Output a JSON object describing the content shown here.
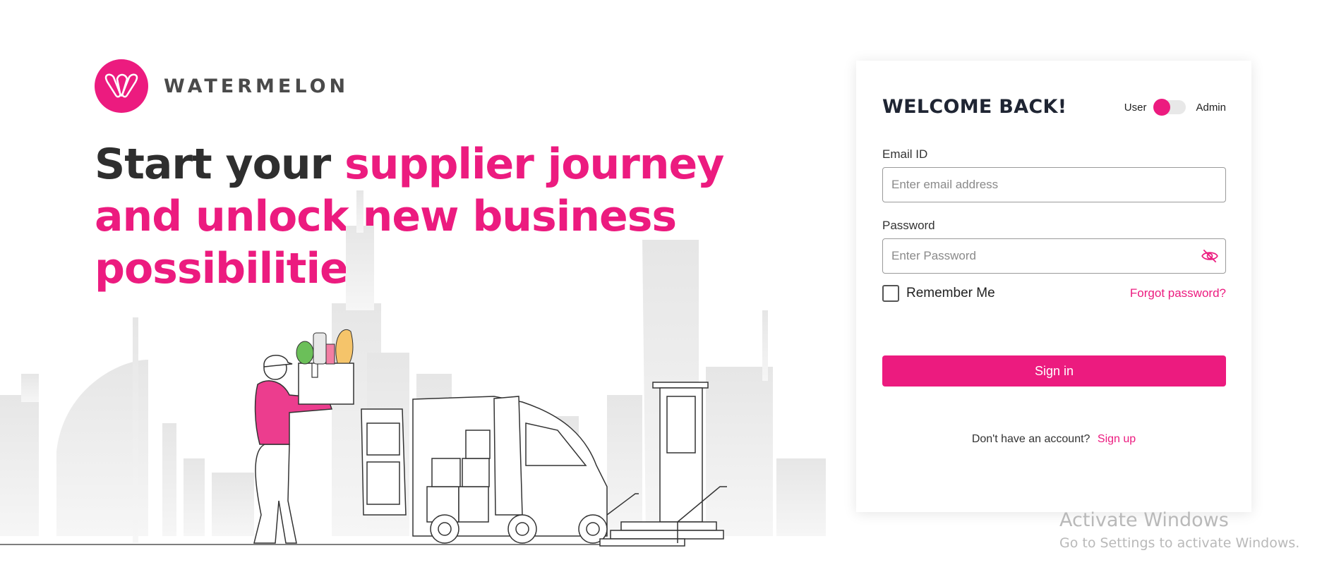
{
  "brand": {
    "name": "WATERMELON",
    "color": "#ec1b7f"
  },
  "headline": {
    "part1": "Start your ",
    "part2": "supplier journey and unlock new business possibilities"
  },
  "login": {
    "title": "WELCOME BACK!",
    "role_toggle": {
      "left": "User",
      "right": "Admin",
      "selected": "User"
    },
    "email": {
      "label": "Email ID",
      "placeholder": "Enter email address",
      "value": ""
    },
    "password": {
      "label": "Password",
      "placeholder": "Enter Password",
      "value": ""
    },
    "remember_label": "Remember Me",
    "remember_checked": false,
    "forgot_label": "Forgot password?",
    "signin_label": "Sign in",
    "signup_prompt": "Don't have an account?",
    "signup_label": "Sign up"
  },
  "watermark": {
    "title": "Activate Windows",
    "subtitle": "Go to Settings to activate Windows."
  }
}
